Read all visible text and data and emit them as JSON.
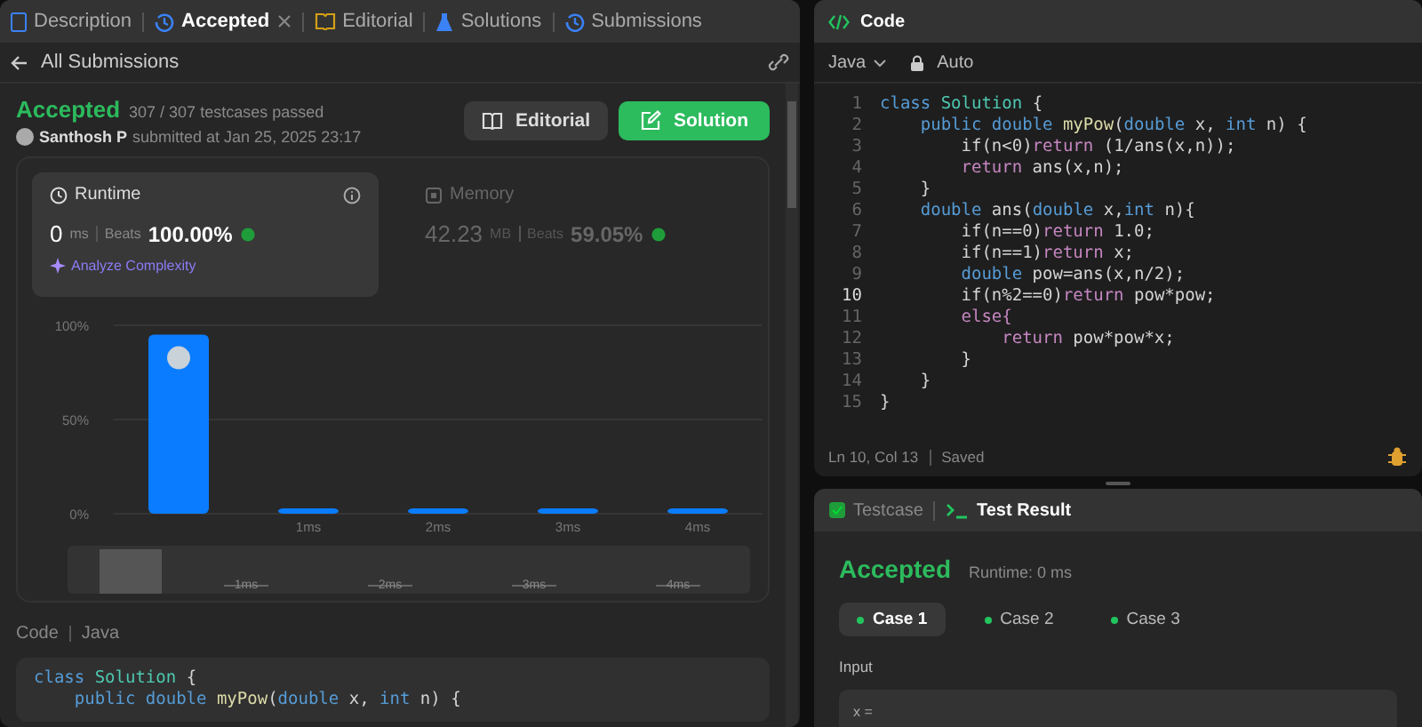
{
  "left_tabs": [
    {
      "label": "Description",
      "kind": "document",
      "selected": false,
      "closable": false
    },
    {
      "label": "Accepted",
      "kind": "history",
      "selected": true,
      "closable": true
    },
    {
      "label": "Editorial",
      "kind": "book",
      "selected": false,
      "closable": false
    },
    {
      "label": "Solutions",
      "kind": "flask",
      "selected": false,
      "closable": false
    },
    {
      "label": "Submissions",
      "kind": "history",
      "selected": false,
      "closable": false
    }
  ],
  "back_link": "All Submissions",
  "submission": {
    "status": "Accepted",
    "testcases": "307 / 307 testcases passed",
    "author": "Santhosh P",
    "submitted": "submitted at Jan 25, 2025 23:17"
  },
  "buttons": [
    {
      "label": "Editorial",
      "kind": "secondary"
    },
    {
      "label": "Solution",
      "kind": "primary"
    }
  ],
  "metrics": [
    {
      "title": "Runtime",
      "kind": "runtime",
      "selected": true,
      "value": "0",
      "unit": "ms",
      "beats_label": "Beats",
      "beats": "100.00%",
      "action": "Analyze Complexity"
    },
    {
      "title": "Memory",
      "kind": "memory",
      "selected": false,
      "value": "42.23",
      "unit": "MB",
      "beats_label": "Beats",
      "beats": "59.05%"
    }
  ],
  "chart_data": {
    "type": "bar",
    "categories": [
      null,
      "1ms",
      "2ms",
      "3ms",
      "4ms"
    ],
    "values": [
      95,
      2,
      2,
      2,
      2
    ],
    "ylim": [
      0,
      100
    ],
    "yticks": [
      {
        "value": 0,
        "label": "0%"
      },
      {
        "value": 50,
        "label": "50%"
      },
      {
        "value": 100,
        "label": "100%"
      }
    ]
  },
  "brush": {
    "labels": [
      "1ms",
      "2ms",
      "3ms",
      "4ms"
    ]
  },
  "code_section": {
    "title": "Code",
    "language": "Java",
    "lines": [
      [
        {
          "text": "class ",
          "kind": "keyword"
        },
        {
          "text": "Solution",
          "kind": "type"
        },
        {
          "text": " {",
          "kind": "plain"
        }
      ],
      [
        {
          "text": "    public double ",
          "kind": "keyword"
        },
        {
          "text": "myPow",
          "kind": "function"
        },
        {
          "text": "(",
          "kind": "plain"
        },
        {
          "text": "double",
          "kind": "keyword"
        },
        {
          "text": " x, ",
          "kind": "plain"
        },
        {
          "text": "int",
          "kind": "keyword"
        },
        {
          "text": " n) {",
          "kind": "plain"
        }
      ]
    ]
  },
  "editor": {
    "title": "Code",
    "language": "Java",
    "mode": "Auto",
    "status": "Ln 10, Col 13",
    "saved": "Saved",
    "lines": [
      {
        "number": "1",
        "current": false,
        "tokens": [
          {
            "text": "class ",
            "kind": "keyword"
          },
          {
            "text": "Solution",
            "kind": "type"
          },
          {
            "text": " {",
            "kind": "plain"
          }
        ]
      },
      {
        "number": "2",
        "current": false,
        "tokens": [
          {
            "text": "    public double ",
            "kind": "keyword"
          },
          {
            "text": "myPow",
            "kind": "function"
          },
          {
            "text": "(",
            "kind": "plain"
          },
          {
            "text": "double",
            "kind": "keyword"
          },
          {
            "text": " x, ",
            "kind": "plain"
          },
          {
            "text": "int",
            "kind": "keyword"
          },
          {
            "text": " n) {",
            "kind": "plain"
          }
        ]
      },
      {
        "number": "3",
        "current": false,
        "tokens": [
          {
            "text": "        if(n<0)",
            "kind": "plain"
          },
          {
            "text": "return",
            "kind": "control"
          },
          {
            "text": " (1/ans(x,n));",
            "kind": "plain"
          }
        ]
      },
      {
        "number": "4",
        "current": false,
        "tokens": [
          {
            "text": "        return",
            "kind": "control"
          },
          {
            "text": " ans(x,n);",
            "kind": "plain"
          }
        ]
      },
      {
        "number": "5",
        "current": false,
        "tokens": [
          {
            "text": "    }",
            "kind": "plain"
          }
        ]
      },
      {
        "number": "6",
        "current": false,
        "tokens": [
          {
            "text": "    double",
            "kind": "keyword"
          },
          {
            "text": " ans(",
            "kind": "plain"
          },
          {
            "text": "double",
            "kind": "keyword"
          },
          {
            "text": " x,",
            "kind": "plain"
          },
          {
            "text": "int",
            "kind": "keyword"
          },
          {
            "text": " n){",
            "kind": "plain"
          }
        ]
      },
      {
        "number": "7",
        "current": false,
        "tokens": [
          {
            "text": "        if(n==0)",
            "kind": "plain"
          },
          {
            "text": "return",
            "kind": "control"
          },
          {
            "text": " 1.0;",
            "kind": "plain"
          }
        ]
      },
      {
        "number": "8",
        "current": false,
        "tokens": [
          {
            "text": "        if(n==1)",
            "kind": "plain"
          },
          {
            "text": "return",
            "kind": "control"
          },
          {
            "text": " x;",
            "kind": "plain"
          }
        ]
      },
      {
        "number": "9",
        "current": false,
        "tokens": [
          {
            "text": "        double",
            "kind": "keyword"
          },
          {
            "text": " pow=ans(x,n/2);",
            "kind": "plain"
          }
        ]
      },
      {
        "number": "10",
        "current": true,
        "tokens": [
          {
            "text": "        if(n%2==0)",
            "kind": "plain"
          },
          {
            "text": "return",
            "kind": "control"
          },
          {
            "text": " pow*pow;",
            "kind": "plain"
          }
        ]
      },
      {
        "number": "11",
        "current": false,
        "tokens": [
          {
            "text": "        else{",
            "kind": "control"
          }
        ]
      },
      {
        "number": "12",
        "current": false,
        "tokens": [
          {
            "text": "            return",
            "kind": "control"
          },
          {
            "text": " pow*pow*x;",
            "kind": "plain"
          }
        ]
      },
      {
        "number": "13",
        "current": false,
        "tokens": [
          {
            "text": "        }",
            "kind": "plain"
          }
        ]
      },
      {
        "number": "14",
        "current": false,
        "tokens": [
          {
            "text": "    }",
            "kind": "plain"
          }
        ]
      },
      {
        "number": "15",
        "current": false,
        "tokens": [
          {
            "text": "}",
            "kind": "plain"
          }
        ]
      }
    ]
  },
  "result_tabs": [
    {
      "label": "Testcase",
      "kind": "testcase",
      "selected": false
    },
    {
      "label": "Test Result",
      "kind": "result",
      "selected": true
    }
  ],
  "result": {
    "status": "Accepted",
    "runtime": "Runtime: 0 ms",
    "cases": [
      {
        "label": "Case 1",
        "selected": true
      },
      {
        "label": "Case 2",
        "selected": false
      },
      {
        "label": "Case 3",
        "selected": false
      }
    ],
    "input_label": "Input",
    "input_value": "x ="
  }
}
